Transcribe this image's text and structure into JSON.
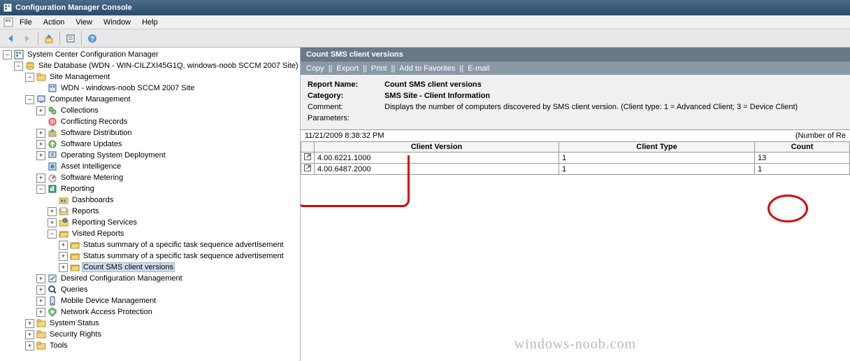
{
  "window_title": "Configuration Manager Console",
  "menu": [
    "File",
    "Action",
    "View",
    "Window",
    "Help"
  ],
  "tree": [
    {
      "d": 0,
      "e": "-",
      "i": "console",
      "t": "System Center Configuration Manager"
    },
    {
      "d": 1,
      "e": "-",
      "i": "db",
      "t": "Site Database  (WDN - WIN-CILZXI45G1Q, windows-noob SCCM 2007 Site)"
    },
    {
      "d": 2,
      "e": "-",
      "i": "folder-y",
      "t": "Site Management"
    },
    {
      "d": 3,
      "e": "",
      "i": "site",
      "t": "WDN - windows-noob SCCM 2007 Site"
    },
    {
      "d": 2,
      "e": "-",
      "i": "comp",
      "t": "Computer Management"
    },
    {
      "d": 3,
      "e": "+",
      "i": "coll",
      "t": "Collections"
    },
    {
      "d": 3,
      "e": "",
      "i": "conf",
      "t": "Conflicting Records"
    },
    {
      "d": 3,
      "e": "+",
      "i": "swd",
      "t": "Software Distribution"
    },
    {
      "d": 3,
      "e": "+",
      "i": "swu",
      "t": "Software Updates"
    },
    {
      "d": 3,
      "e": "+",
      "i": "osd",
      "t": "Operating System Deployment"
    },
    {
      "d": 3,
      "e": "",
      "i": "asset",
      "t": "Asset Intelligence"
    },
    {
      "d": 3,
      "e": "+",
      "i": "meter",
      "t": "Software Metering"
    },
    {
      "d": 3,
      "e": "-",
      "i": "report",
      "t": "Reporting"
    },
    {
      "d": 4,
      "e": "",
      "i": "dash",
      "t": "Dashboards"
    },
    {
      "d": 4,
      "e": "+",
      "i": "rep",
      "t": "Reports"
    },
    {
      "d": 4,
      "e": "+",
      "i": "repsvc",
      "t": "Reporting Services"
    },
    {
      "d": 4,
      "e": "-",
      "i": "folder-o",
      "t": "Visited Reports"
    },
    {
      "d": 5,
      "e": "+",
      "i": "folder-o",
      "t": "Status summary of a specific task sequence advertisement"
    },
    {
      "d": 5,
      "e": "+",
      "i": "folder-o",
      "t": "Status summary of a specific task sequence advertisement"
    },
    {
      "d": 5,
      "e": "+",
      "i": "folder-o",
      "t": "Count SMS client versions",
      "sel": true
    },
    {
      "d": 3,
      "e": "+",
      "i": "dcm",
      "t": "Desired Configuration Management"
    },
    {
      "d": 3,
      "e": "+",
      "i": "query",
      "t": "Queries"
    },
    {
      "d": 3,
      "e": "+",
      "i": "mobile",
      "t": "Mobile Device Management"
    },
    {
      "d": 3,
      "e": "+",
      "i": "nap",
      "t": "Network Access Protection"
    },
    {
      "d": 2,
      "e": "+",
      "i": "folder-y",
      "t": "System Status"
    },
    {
      "d": 2,
      "e": "+",
      "i": "folder-y",
      "t": "Security Rights"
    },
    {
      "d": 2,
      "e": "+",
      "i": "folder-y",
      "t": "Tools"
    }
  ],
  "report": {
    "title": "Count SMS client versions",
    "actions": [
      "Copy",
      "Export",
      "Print",
      "Add to Favorites",
      "E-mail"
    ],
    "labels": {
      "report_name": "Report Name:",
      "category": "Category:",
      "comment": "Comment:",
      "parameters": "Parameters:"
    },
    "name": "Count SMS client versions",
    "category": "SMS Site - Client Information",
    "comment": "Displays the number of computers discovered by SMS client version. (Client type: 1 = Advanced Client; 3 = Device Client)",
    "parameters": "",
    "timestamp": "11/21/2009 8:38:32 PM",
    "records_label": "(Number of Re",
    "columns": [
      "Client Version",
      "Client Type",
      "Count"
    ],
    "rows": [
      {
        "version": "4.00.6221.1000",
        "type": "1",
        "count": "13"
      },
      {
        "version": "4.00.6487.2000",
        "type": "1",
        "count": "1"
      }
    ]
  },
  "watermark": "windows-noob.com"
}
